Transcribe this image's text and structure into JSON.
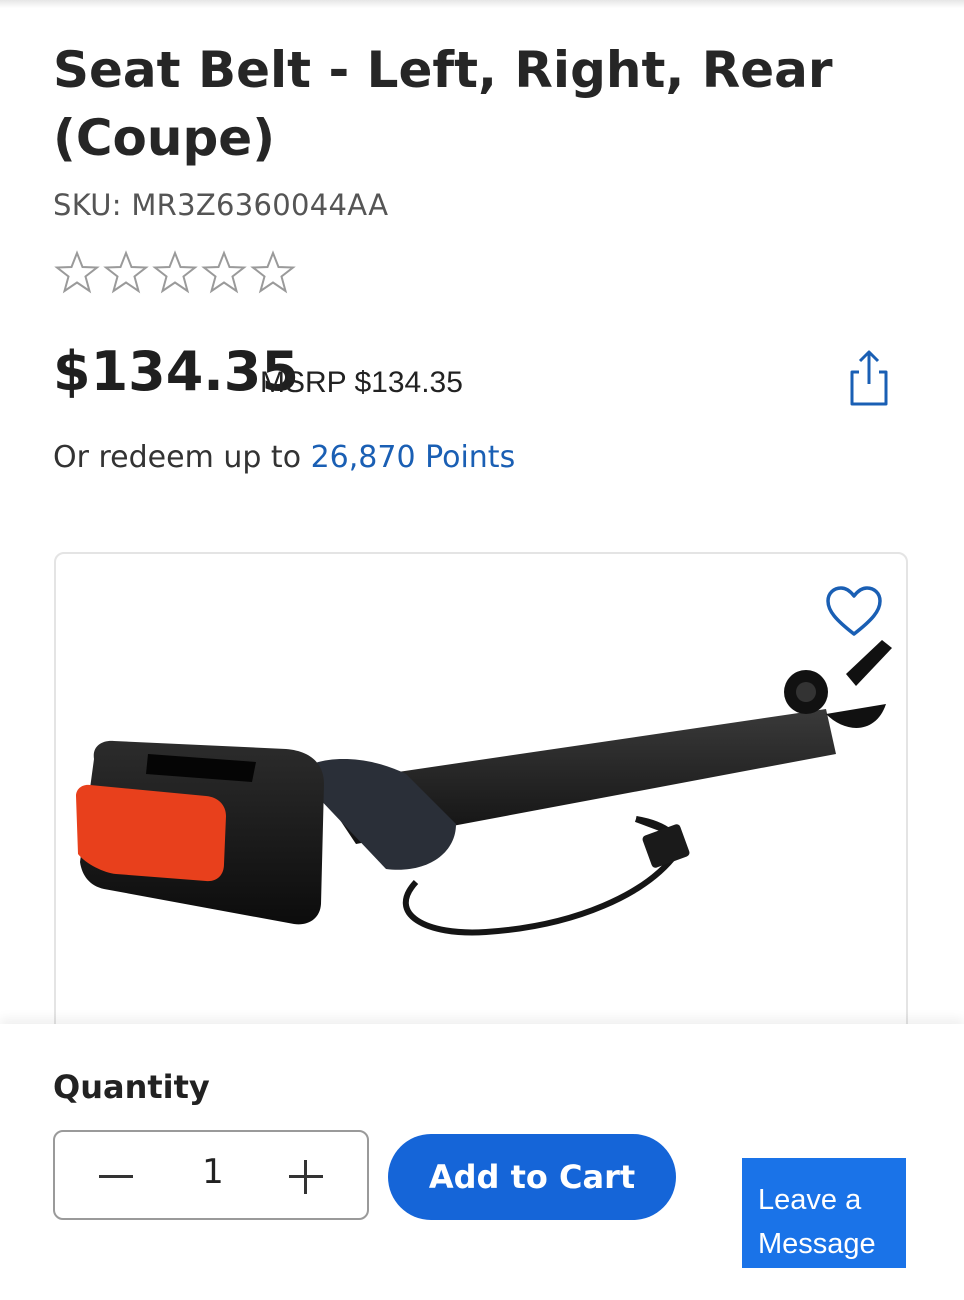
{
  "product": {
    "title": "Seat Belt - Left, Right, Rear (Coupe)",
    "sku": "SKU: MR3Z6360044AA",
    "rating_stars": 0,
    "rating_max": 5,
    "price": "$134.35",
    "msrp": "MSRP $134.35",
    "redeem_prefix": "Or redeem up to ",
    "redeem_points": "26,870 Points"
  },
  "purchase": {
    "quantity_label": "Quantity",
    "quantity_value": "1",
    "add_to_cart_label": "Add to Cart"
  },
  "chat": {
    "leave_message_line1": "Leave a",
    "leave_message_line2": "Message"
  },
  "colors": {
    "accent": "#1565d8",
    "link": "#1a5fb4",
    "buckle_release": "#e8401c"
  },
  "icons": [
    "star-outline-icon",
    "share-icon",
    "heart-icon",
    "minus-icon",
    "plus-icon"
  ]
}
